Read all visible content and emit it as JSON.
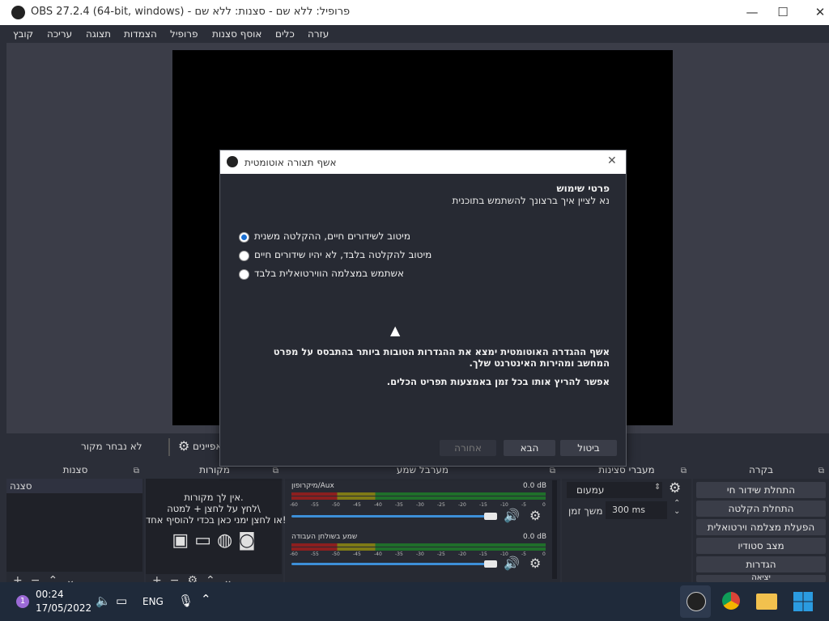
{
  "window": {
    "title": "OBS 27.2.4 (64-bit, windows) - פרופיל: ללא שם - סצנות: ללא שם",
    "min_label": "—",
    "max_label": "☐",
    "close_label": "✕"
  },
  "menu": [
    "קובץ",
    "עריכה",
    "תצוגה",
    "הצמדות",
    "פרופיל",
    "אוסף סצנות",
    "כלים",
    "עזרה"
  ],
  "source_bar": {
    "no_source": "לא נבחר מקור",
    "properties": "מאפיינים"
  },
  "docks": {
    "scenes": {
      "title": "סצנות",
      "items": [
        "סצנה"
      ]
    },
    "sources": {
      "title": "מקורות",
      "empty_line1": "אין לך מקורות.",
      "empty_line2": "לחץ על לחצן + למטה\\",
      "empty_line3": "או לחצן ימני כאן בכדי להוסיף אחד!"
    },
    "mixer": {
      "title": "מערבל שמע",
      "channels": [
        {
          "name": "מיקרופון/Aux",
          "db": "0.0 dB"
        },
        {
          "name": "שמע בשולחן העבודה",
          "db": "0.0 dB"
        }
      ],
      "ticks": [
        "-60",
        "-55",
        "-50",
        "-45",
        "-40",
        "-35",
        "-30",
        "-25",
        "-20",
        "-15",
        "-10",
        "-5",
        "0"
      ]
    },
    "transitions": {
      "title": "מעברי סצינות",
      "type": "עמעום",
      "duration_label": "משך זמן",
      "duration_value": "300 ms"
    },
    "controls": {
      "title": "בקרה",
      "buttons": [
        "התחלת שידור חי",
        "התחלת הקלטה",
        "הפעלת מצלמה וירטואלית",
        "מצב סטודיו",
        "הגדרות",
        "יציאה"
      ]
    }
  },
  "dialog": {
    "title": "אשף תצורה אוטומטית",
    "close_label": "✕",
    "heading": "פרטי שימוש",
    "subheading": "נא לציין איך ברצונך להשתמש בתוכנית",
    "options": [
      "מיטוב לשידורים חיים, ההקלטה משנית",
      "מיטוב להקלטה בלבד, לא יהיו שידורים חיים",
      "אשתמש במצלמה הווירטואלית בלבד"
    ],
    "selected_index": 0,
    "info1a": "אשף ההגדרה האוטומטית ימצא את ההגדרות הטובות ביותר בהתבסס על מפרט",
    "info1b": "המחשב ומהירות האינטרנט שלך.",
    "info2": "אפשר להריץ אותו בכל זמן באמצעות תפריט הכלים.",
    "back": "אחורה",
    "next": "הבא",
    "cancel": "ביטול"
  },
  "taskbar": {
    "badge": "1",
    "time": "00:24",
    "date": "17/05/2022",
    "lang": "ENG"
  },
  "colors": {
    "accent": "#1a6fd1",
    "slider": "#3d8fd8"
  }
}
